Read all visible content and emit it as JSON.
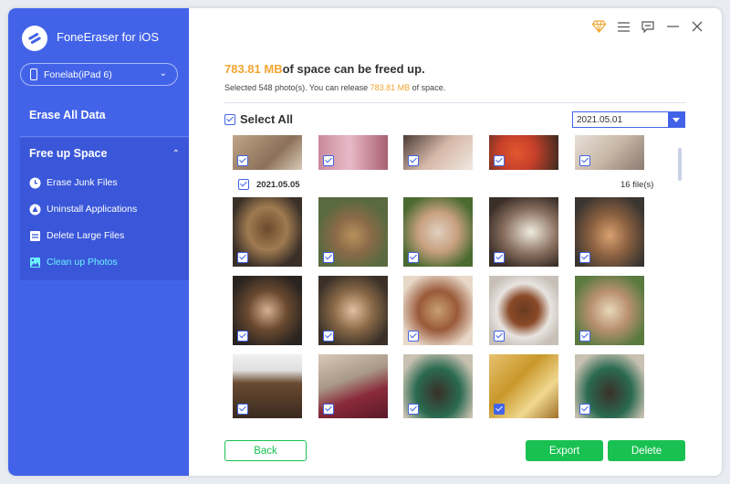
{
  "app": {
    "title": "FoneEraser for iOS"
  },
  "device": {
    "name": "Fonelab(iPad 6)"
  },
  "sidebar": {
    "erase_all": "Erase All Data",
    "free_group": "Free up Space",
    "items": [
      {
        "label": "Erase Junk Files",
        "icon": "clock-icon"
      },
      {
        "label": "Uninstall Applications",
        "icon": "apps-icon"
      },
      {
        "label": "Delete Large Files",
        "icon": "file-icon"
      },
      {
        "label": "Clean up Photos",
        "icon": "photo-icon",
        "active": true
      }
    ]
  },
  "summary": {
    "size": "783.81 MB",
    "freed_suffix": "of space can be freed up.",
    "selected_prefix": "Selected ",
    "selected_count": "548",
    "selected_mid": " photo(s). You can release ",
    "release_size": "783.81 MB",
    "release_suffix": " of space."
  },
  "select_all": "Select All",
  "date_filter": "2021.05.01",
  "group": {
    "date": "2021.05.05",
    "count": "16 file(s)"
  },
  "buttons": {
    "back": "Back",
    "export": "Export",
    "delete": "Delete"
  },
  "colors": {
    "sidebar": "#4263e8",
    "accent": "#f2a531",
    "green": "#19c152"
  }
}
